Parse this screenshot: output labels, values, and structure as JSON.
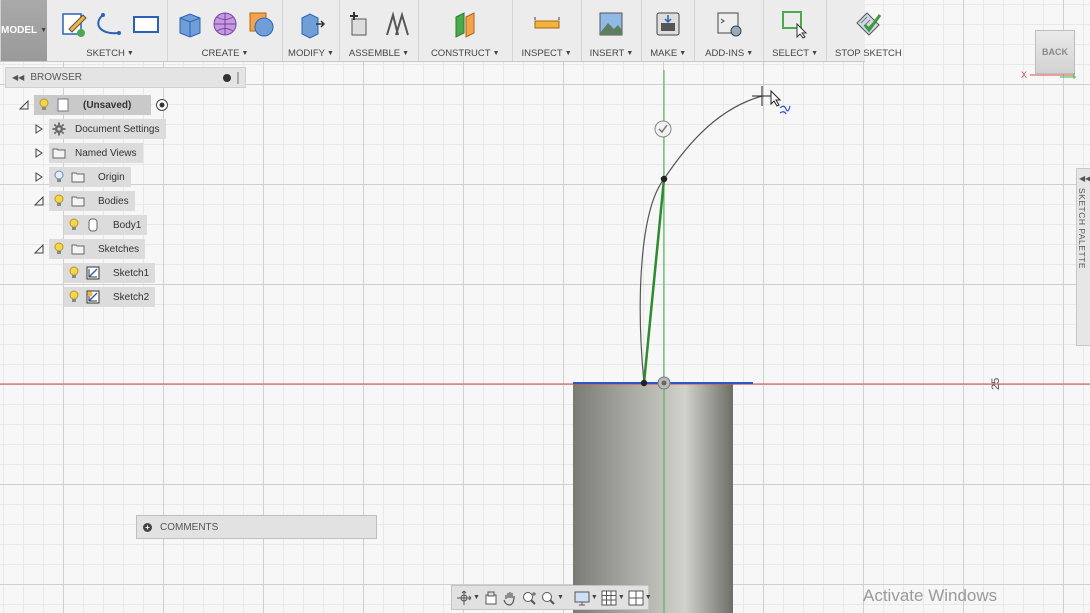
{
  "toolbar": {
    "workspace": "MODEL",
    "groups": [
      {
        "label": "SKETCH",
        "icons": [
          "create-sketch-icon",
          "arc-icon",
          "rectangle-icon"
        ]
      },
      {
        "label": "CREATE",
        "icons": [
          "box-icon",
          "mesh-sphere-icon",
          "cylinder-icon"
        ]
      },
      {
        "label": "MODIFY",
        "icons": [
          "press-pull-icon"
        ]
      },
      {
        "label": "ASSEMBLE",
        "icons": [
          "new-component-icon",
          "joint-icon"
        ]
      },
      {
        "label": "CONSTRUCT",
        "icons": [
          "offset-plane-icon"
        ]
      },
      {
        "label": "INSPECT",
        "icons": [
          "measure-icon"
        ]
      },
      {
        "label": "INSERT",
        "icons": [
          "insert-image-icon"
        ]
      },
      {
        "label": "MAKE",
        "icons": [
          "3d-print-icon"
        ]
      },
      {
        "label": "ADD-INS",
        "icons": [
          "scripts-icon"
        ]
      },
      {
        "label": "SELECT",
        "icons": [
          "select-icon"
        ]
      },
      {
        "label": "STOP SKETCH",
        "icons": [
          "stop-sketch-icon"
        ]
      }
    ]
  },
  "browser": {
    "title": "BROWSER",
    "items": [
      {
        "label": "(Unsaved)",
        "level": 0,
        "expanded": true
      },
      {
        "label": "Document Settings",
        "level": 1,
        "icon": "gear-icon"
      },
      {
        "label": "Named Views",
        "level": 1,
        "icon": "folder-icon"
      },
      {
        "label": "Origin",
        "level": 1,
        "icon": "folder-icon"
      },
      {
        "label": "Bodies",
        "level": 1,
        "icon": "folder-icon"
      },
      {
        "label": "Body1",
        "level": 2,
        "icon": "body-icon"
      },
      {
        "label": "Sketches",
        "level": 1,
        "icon": "folder-icon"
      },
      {
        "label": "Sketch1",
        "level": 2,
        "icon": "sketch-icon"
      },
      {
        "label": "Sketch2",
        "level": 2,
        "icon": "sketch-icon"
      }
    ]
  },
  "viewcube": {
    "face": "BACK",
    "axis": "X"
  },
  "sketch_palette": {
    "label": "SKETCH PALETTE"
  },
  "comments": {
    "label": "COMMENTS"
  },
  "canvas": {
    "dimension_label": "25"
  },
  "watermark": {
    "text": "Activate Windows"
  },
  "colors": {
    "x_axis": "#d64a4a",
    "y_axis": "#3cb44b",
    "sketch_line": "#2e8b2e",
    "selection_blue": "#2a56c6",
    "body": "#8e8e88"
  }
}
